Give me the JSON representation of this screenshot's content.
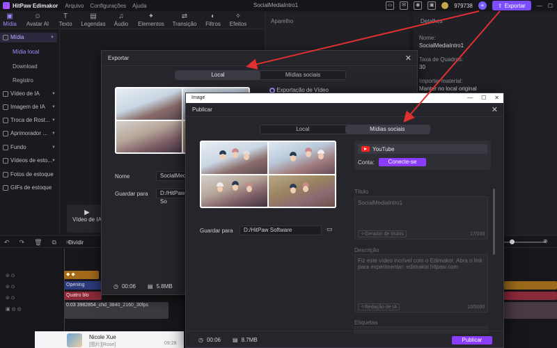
{
  "app": {
    "name": "HitPaw Edimakor",
    "menus": [
      "Arquivo",
      "Configurações",
      "Ajuda"
    ],
    "project": "SocialMediaIntro1",
    "coins": "979738",
    "export_label": "Exportar"
  },
  "toolbar": {
    "tools": [
      {
        "label": "Mídia",
        "icon": "media-icon"
      },
      {
        "label": "Avatar AI",
        "icon": "avatar-icon"
      },
      {
        "label": "Texto",
        "icon": "text-icon"
      },
      {
        "label": "Legendas",
        "icon": "subtitle-icon"
      },
      {
        "label": "Áudio",
        "icon": "audio-icon"
      },
      {
        "label": "Elementos",
        "icon": "elements-icon"
      },
      {
        "label": "Transição",
        "icon": "transition-icon"
      },
      {
        "label": "Filtros",
        "icon": "filter-icon"
      },
      {
        "label": "Efeitos",
        "icon": "effects-icon"
      }
    ],
    "player_label": "Aparelho"
  },
  "sidebar": {
    "media_label": "Mídia",
    "sub": [
      "Mídia local",
      "Download",
      "Registro"
    ],
    "items": [
      "Vídeo de IA",
      "Imagem de IA",
      "Troca de Rost...",
      "Aprimorador ...",
      "Fundo",
      "Vídeos de esto...",
      "Fotos de estoque",
      "GIFs de estoque"
    ]
  },
  "right_panel": {
    "tab": "Detalhes",
    "name_label": "Nome:",
    "name_value": "SocialMediaIntro1",
    "fps_label": "Taxa de Quadros:",
    "fps_value": "30",
    "import_label": "Importar material:",
    "import_value": "Manter no local original"
  },
  "timeline": {
    "split_label": "Dividir",
    "tracks": [
      "Opening",
      "Quatro blo",
      "0:03 3982854_chd_3840_2160_30fps"
    ],
    "import_label": "Vídeo de IA"
  },
  "export_dialog": {
    "title": "Exportar",
    "tab_local": "Local",
    "tab_social": "Mídias sociais",
    "option": "Exportação de Vídeo",
    "name_label": "Nome",
    "name_value": "SocialMed",
    "save_label": "Guardar para",
    "save_value": "D:/HitPaw So",
    "duration": "00:06",
    "size": "5.8MB"
  },
  "image_window": {
    "title": "Image",
    "min": "—",
    "max": "☐",
    "close": "✕"
  },
  "publish_dialog": {
    "title": "Publicar",
    "tab_local": "Local",
    "tab_social": "Mídias sociais",
    "platform": "YouTube",
    "account_label": "Conta:",
    "connect_label": "Conecte-se",
    "title_label": "Título",
    "title_value": "SocialMediaIntro1",
    "title_ai": "Gerador de títulos",
    "title_count": "17/100",
    "desc_label": "Descrição",
    "desc_value": "Fiz este vídeo incrível com o Edimakor. Abra o link para experimentar: edimakor.hitpaw.com",
    "desc_ai": "Redação de IA",
    "desc_count": "10/5000",
    "tags_label": "Etiquetas",
    "save_label": "Guardar para",
    "save_value": "D:/HitPaw Software",
    "duration": "00:06",
    "size": "8.7MB",
    "publish_label": "Publicar"
  },
  "notification": {
    "name": "Nicole Xue",
    "sub": "[图片][Rose]",
    "time": "09:28"
  },
  "colors": {
    "accent": "#8b3dff",
    "arrow": "#e03030"
  }
}
